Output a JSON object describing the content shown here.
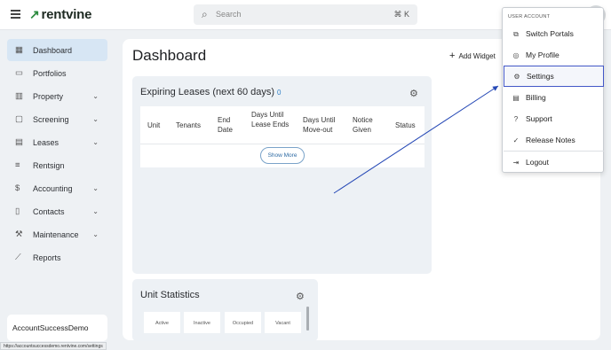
{
  "header": {
    "brand": "rentvine",
    "search_placeholder": "Search",
    "search_shortcut": "⌘ K"
  },
  "sidebar": {
    "items": [
      {
        "label": "Dashboard",
        "icon": "dashboard-icon",
        "active": true
      },
      {
        "label": "Portfolios",
        "icon": "folder-icon"
      },
      {
        "label": "Property",
        "icon": "building-icon",
        "chevron": true
      },
      {
        "label": "Screening",
        "icon": "screening-icon",
        "chevron": true
      },
      {
        "label": "Leases",
        "icon": "document-icon",
        "chevron": true
      },
      {
        "label": "Rentsign",
        "icon": "signature-icon"
      },
      {
        "label": "Accounting",
        "icon": "dollar-icon",
        "chevron": true
      },
      {
        "label": "Contacts",
        "icon": "book-icon",
        "chevron": true
      },
      {
        "label": "Maintenance",
        "icon": "wrench-icon",
        "chevron": true
      },
      {
        "label": "Reports",
        "icon": "chart-icon"
      }
    ],
    "account_name": "AccountSuccessDemo"
  },
  "status_url": "https://accountsuccessdemo.rentvine.com/settings",
  "main": {
    "title": "Dashboard",
    "add_widget": "Add Widget",
    "expiring": {
      "title": "Expiring Leases (next 60 days)",
      "count": "0",
      "columns": [
        "Unit",
        "Tenants",
        "End Date",
        "Days Until Lease Ends",
        "Days Until Move-out",
        "Notice Given",
        "Status"
      ],
      "show_more": "Show More"
    },
    "unit_stats": {
      "title": "Unit Statistics",
      "tiles": [
        "Active",
        "Inactive",
        "Occupied",
        "Vacant"
      ]
    }
  },
  "user_menu": {
    "header": "USER ACCOUNT",
    "items": [
      {
        "label": "Switch Portals",
        "icon": "switch-icon"
      },
      {
        "label": "My Profile",
        "icon": "user-circle-icon"
      },
      {
        "label": "Settings",
        "icon": "settings-icon",
        "highlighted": true
      },
      {
        "label": "Billing",
        "icon": "billing-icon"
      },
      {
        "label": "Support",
        "icon": "help-icon"
      },
      {
        "label": "Release Notes",
        "icon": "check-circle-icon"
      },
      {
        "label": "Logout",
        "icon": "logout-icon"
      }
    ]
  },
  "colors": {
    "brand_green": "#2b8a3e",
    "active_nav": "#d7e6f4",
    "highlight_border": "#4257c7",
    "annotation_arrow": "#2447b5"
  }
}
